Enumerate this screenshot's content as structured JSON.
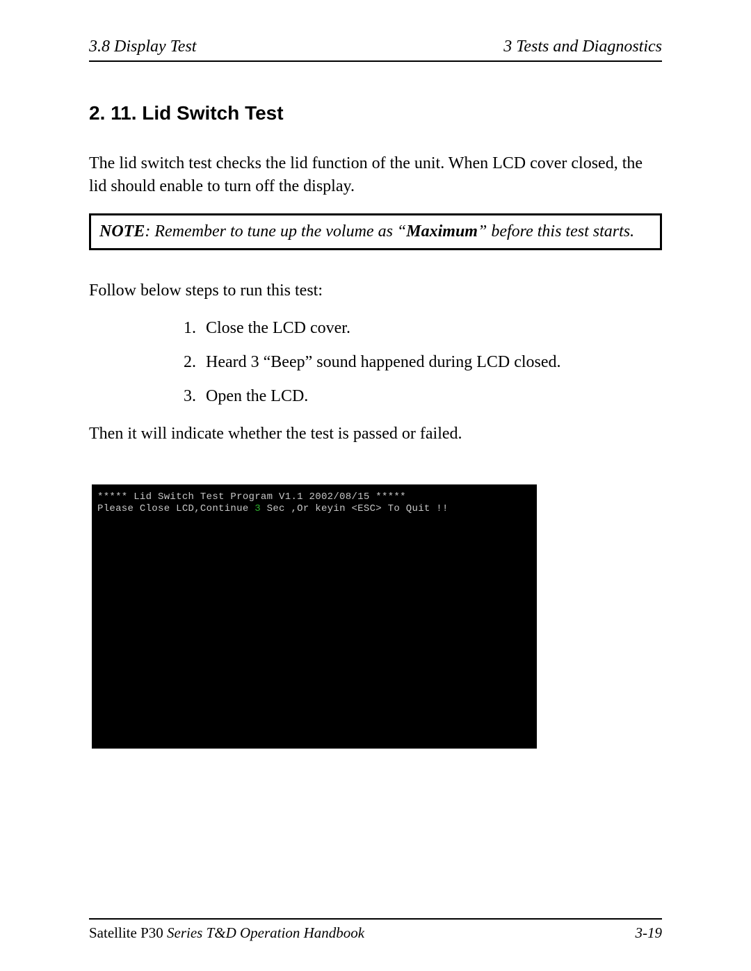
{
  "header": {
    "left": "3.8  Display Test",
    "right": "3  Tests and Diagnostics"
  },
  "section_heading": "2. 11. Lid Switch Test",
  "intro": "The lid switch test checks the lid function of the unit. When LCD cover closed, the lid should enable to turn off the display.",
  "note": {
    "label": "NOTE",
    "sep": ":   ",
    "before": "Remember to tune up the volume as “",
    "bold": "Maximum",
    "after": "” before this test starts."
  },
  "follow_intro": "Follow below steps to run this test:",
  "steps": [
    "Close the LCD cover.",
    "Heard 3 “Beep” sound happened during LCD closed.",
    "Open the LCD."
  ],
  "result_line": "Then it will indicate whether the test is passed or failed.",
  "console": {
    "line1": "***** Lid Switch Test Program V1.1 2002/08/15 *****",
    "line2a": "Please Close LCD,Continue ",
    "line2_green": "3",
    "line2b": " Sec ,Or keyin <ESC> To Quit !!"
  },
  "footer": {
    "left_prefix": "Satellite ",
    "left_model": "P30",
    "left_suffix": " Series T&D Operation Handbook",
    "right": "3-19"
  }
}
